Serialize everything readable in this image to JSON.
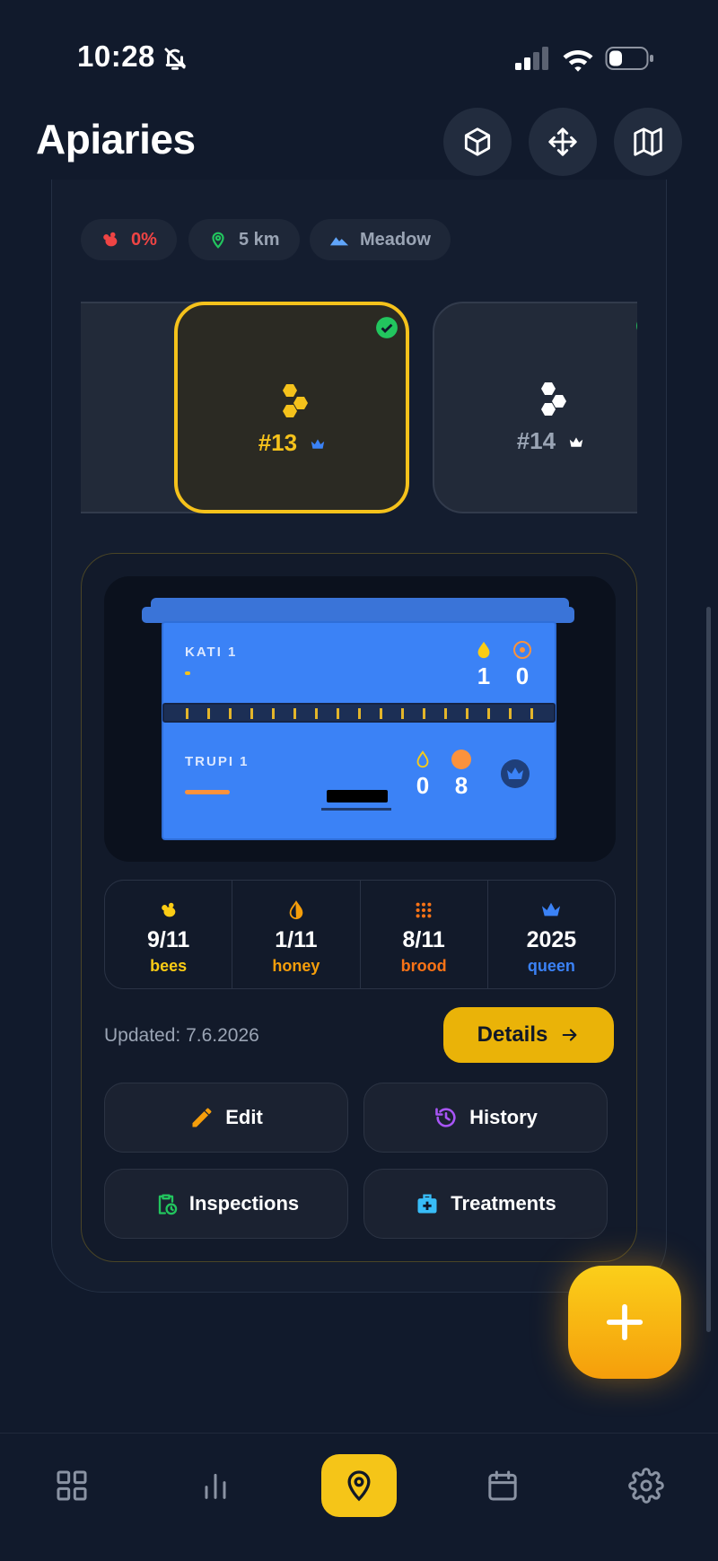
{
  "status_bar": {
    "time": "10:28"
  },
  "header": {
    "title": "Apiaries",
    "actions": [
      {
        "icon": "cube-icon"
      },
      {
        "icon": "move-icon"
      },
      {
        "icon": "map-icon"
      }
    ]
  },
  "chips": [
    {
      "icon": "bee-icon",
      "label": "0%",
      "color": "#ef4444"
    },
    {
      "icon": "location-pin-icon",
      "label": "5 km",
      "color": "#22c55e"
    },
    {
      "icon": "mountain-icon",
      "label": "Meadow",
      "color": "#60a5fa"
    }
  ],
  "hives": [
    {
      "label": "",
      "checked": true,
      "active": false
    },
    {
      "label": "#13",
      "checked": true,
      "active": true
    },
    {
      "label": "#14",
      "checked": true,
      "active": false
    }
  ],
  "hive_visual": {
    "upper_box": {
      "name": "KATI 1",
      "honey": "1",
      "brood": "0"
    },
    "lower_box": {
      "name": "TRUPI 1",
      "honey": "0",
      "brood": "8"
    }
  },
  "stats": [
    {
      "icon": "bee-icon",
      "value": "9/11",
      "label": "bees",
      "color": "#facc15"
    },
    {
      "icon": "honey-drop-icon",
      "value": "1/11",
      "label": "honey",
      "color": "#f59e0b"
    },
    {
      "icon": "brood-grid-icon",
      "value": "8/11",
      "label": "brood",
      "color": "#f97316"
    },
    {
      "icon": "crown-icon",
      "value": "2025",
      "label": "queen",
      "color": "#3b82f6"
    }
  ],
  "updated_text": "Updated: 7.6.2026",
  "details_label": "Details",
  "actions": {
    "edit": "Edit",
    "history": "History",
    "inspections": "Inspections",
    "treatments": "Treatments"
  },
  "nav": [
    {
      "icon": "grid-icon",
      "active": false
    },
    {
      "icon": "bar-chart-icon",
      "active": false
    },
    {
      "icon": "location-pin-icon",
      "active": true
    },
    {
      "icon": "calendar-icon",
      "active": false
    },
    {
      "icon": "gear-icon",
      "active": false
    }
  ],
  "colors": {
    "accent": "#f5c21b",
    "background": "#111a2c",
    "hive_blue": "#3b82f6"
  }
}
